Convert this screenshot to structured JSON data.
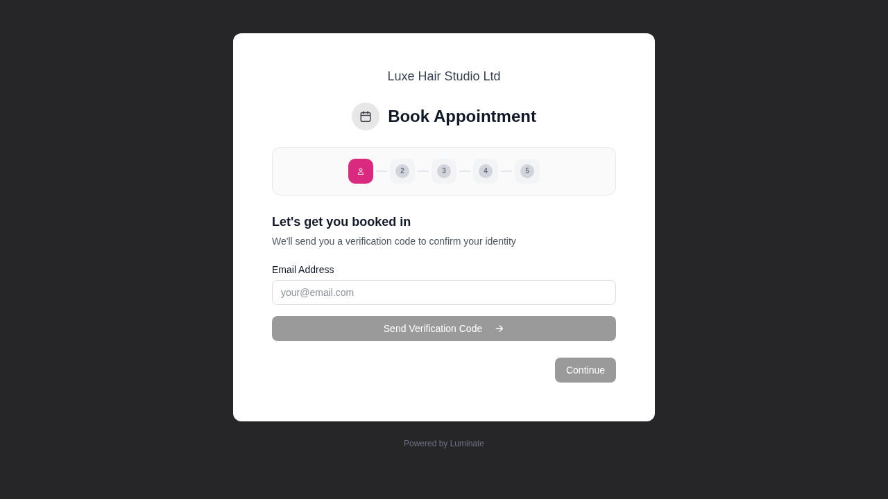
{
  "company": {
    "name": "Luxe Hair Studio Ltd"
  },
  "header": {
    "title": "Book Appointment"
  },
  "steps": [
    {
      "kind": "icon",
      "current": true
    },
    {
      "kind": "number",
      "label": "2",
      "current": false
    },
    {
      "kind": "number",
      "label": "3",
      "current": false
    },
    {
      "kind": "number",
      "label": "4",
      "current": false
    },
    {
      "kind": "number",
      "label": "5",
      "current": false
    }
  ],
  "form": {
    "title": "Let's get you booked in",
    "subtitle": "We'll send you a verification code to confirm your identity",
    "email_field": {
      "label": "Email Address",
      "placeholder": "your@email.com"
    },
    "send_button": {
      "label": "Send Verification Code",
      "disabled": true
    },
    "continue_button": {
      "label": "Continue",
      "disabled": true
    }
  },
  "footer": {
    "text": "Powered by Luminate"
  }
}
